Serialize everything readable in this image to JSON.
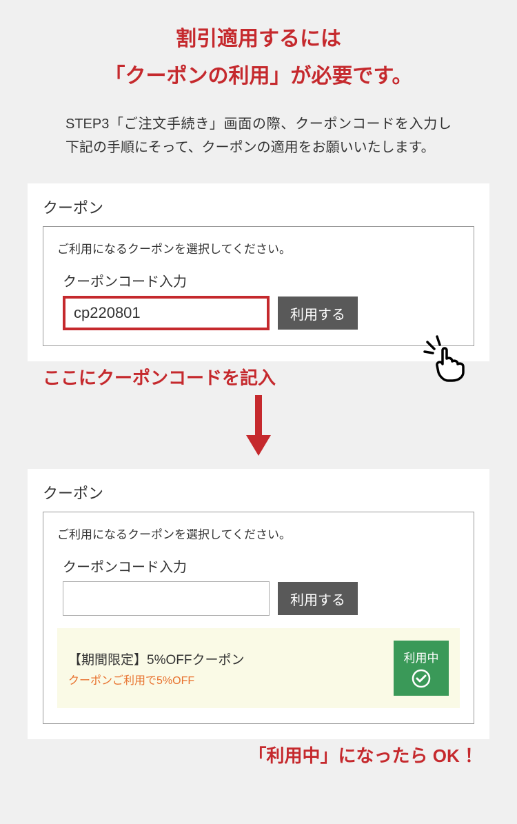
{
  "heading": {
    "line1": "割引適用するには",
    "line2": "「クーポンの利用」が必要です。"
  },
  "description": "STEP3「ご注文手続き」画面の際、クーポンコードを入力し下記の手順にそって、クーポンの適用をお願いいたします。",
  "panel1": {
    "title": "クーポン",
    "hint": "ご利用になるクーポンを選択してください。",
    "inputLabel": "クーポンコード入力",
    "inputValue": "cp220801",
    "buttonLabel": "利用する"
  },
  "annotation1": "ここにクーポンコードを記入",
  "panel2": {
    "title": "クーポン",
    "hint": "ご利用になるクーポンを選択してください。",
    "inputLabel": "クーポンコード入力",
    "inputValue": "",
    "buttonLabel": "利用する",
    "status": {
      "title": "【期間限定】5%OFFクーポン",
      "sub": "クーポンご利用で5%OFF",
      "badge": "利用中"
    }
  },
  "annotation2": "「利用中」になったら OK ！"
}
